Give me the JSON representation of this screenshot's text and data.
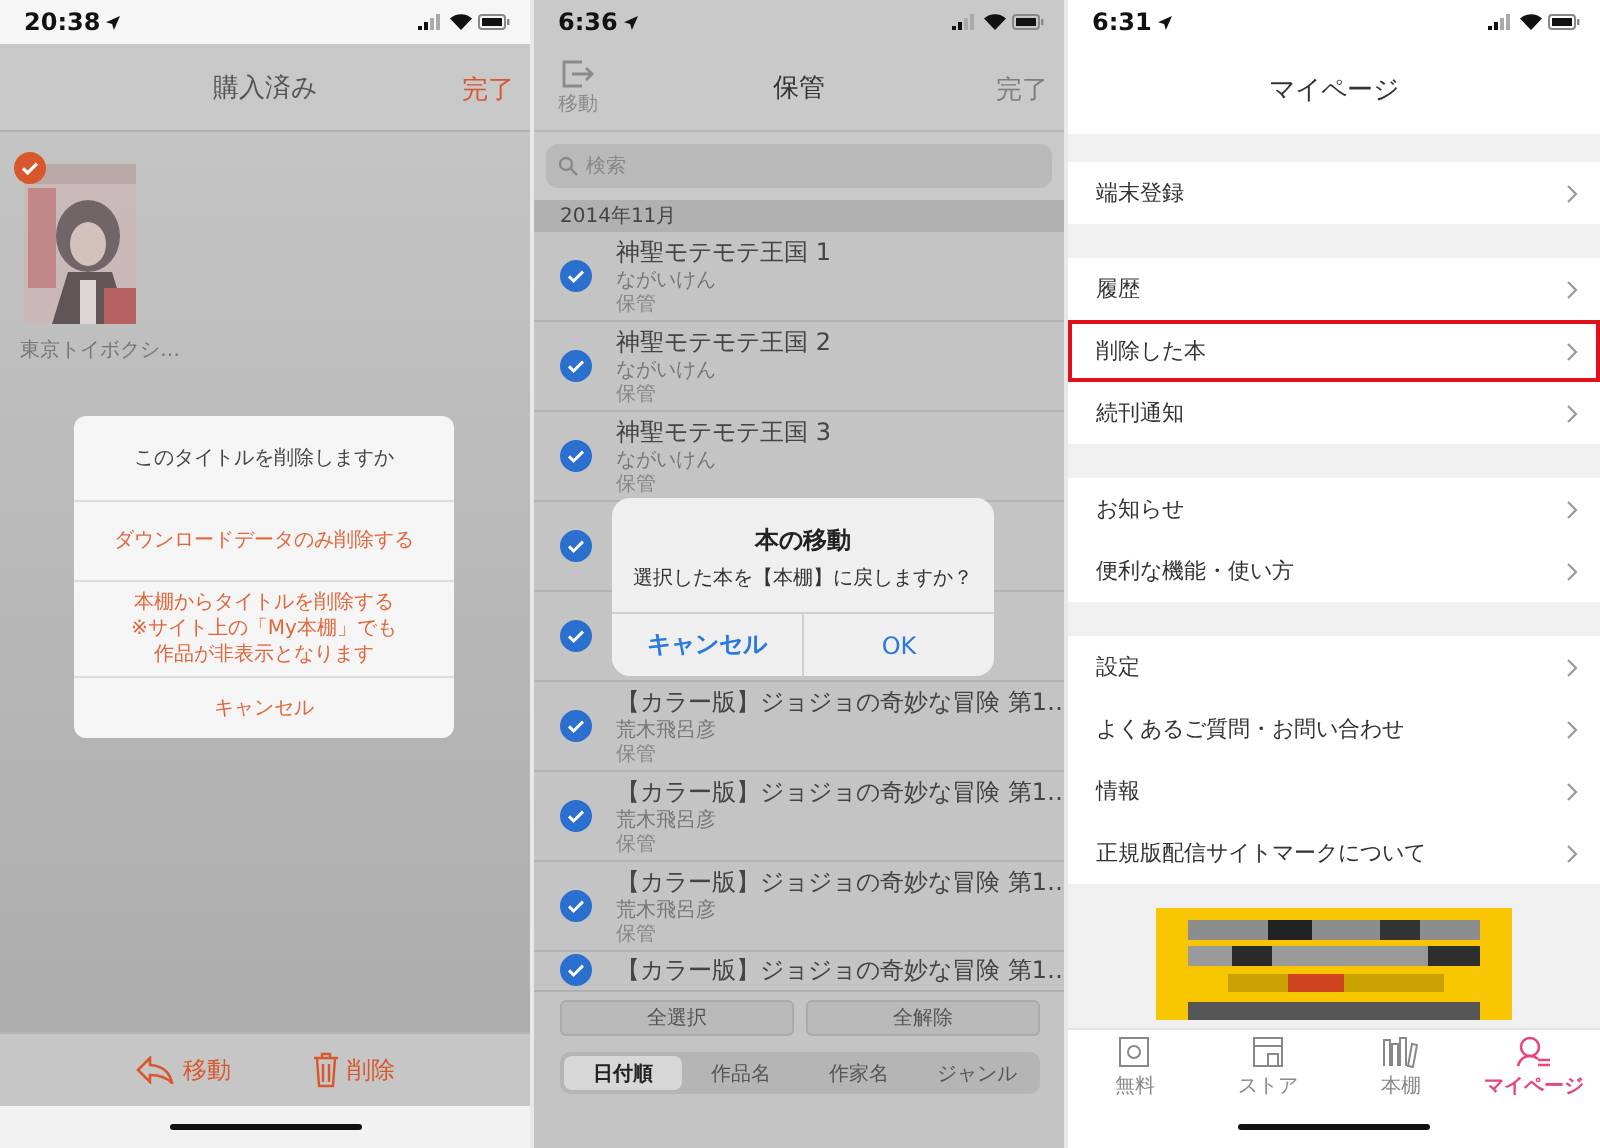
{
  "screens": [
    {
      "kind": "purchased",
      "status_time": "20:38",
      "title": "購入済み",
      "done": "完了",
      "books": [
        {
          "caption": "東京トイボクシ…",
          "checked": true
        }
      ],
      "dialog": {
        "message": "このタイトルを削除しますか",
        "options": [
          {
            "text": "ダウンロードデータのみ削除する"
          },
          {
            "lines": [
              "本棚からタイトルを削除する",
              "※サイト上の「My本棚」でも",
              "作品が非表示となります"
            ]
          },
          {
            "text": "キャンセル"
          }
        ]
      },
      "toolbar": [
        {
          "label": "移動"
        },
        {
          "label": "削除"
        }
      ]
    },
    {
      "kind": "storage",
      "status_time": "6:36",
      "move_label": "移動",
      "title": "保管",
      "done": "完了",
      "search": {
        "placeholder": "検索"
      },
      "section": "2014年11月",
      "rows": [
        {
          "title": "神聖モテモテ王国 1",
          "author": "ながいけん",
          "status": "保管",
          "checked": true
        },
        {
          "title": "神聖モテモテ王国 2",
          "author": "ながいけん",
          "status": "保管",
          "checked": true
        },
        {
          "title": "神聖モテモテ王国 3",
          "author": "ながいけん",
          "status": "保管",
          "checked": true
        },
        {
          "checked": true
        },
        {
          "checked": true
        },
        {
          "title": "【カラー版】ジョジョの奇妙な冒険 第1…",
          "author": "荒木飛呂彦",
          "status": "保管",
          "checked": true
        },
        {
          "title": "【カラー版】ジョジョの奇妙な冒険 第1…",
          "author": "荒木飛呂彦",
          "status": "保管",
          "checked": true
        },
        {
          "title": "【カラー版】ジョジョの奇妙な冒険 第1…",
          "author": "荒木飛呂彦",
          "status": "保管",
          "checked": true
        },
        {
          "title": "【カラー版】ジョジョの奇妙な冒険 第1…",
          "checked": true
        }
      ],
      "dialog": {
        "title": "本の移動",
        "message": "選択した本を【本棚】に戻しますか？",
        "buttons": [
          {
            "label": "キャンセル",
            "bold": true
          },
          {
            "label": "OK",
            "bold": false
          }
        ]
      },
      "actions": [
        "全選択",
        "全解除"
      ],
      "sort": [
        {
          "label": "日付順",
          "selected": true
        },
        {
          "label": "作品名",
          "selected": false
        },
        {
          "label": "作家名",
          "selected": false
        },
        {
          "label": "ジャンル",
          "selected": false
        }
      ]
    },
    {
      "kind": "mypage",
      "status_time": "6:31",
      "title": "マイページ",
      "groups": [
        {
          "items": [
            {
              "label": "端末登録",
              "highlighted": false
            }
          ]
        },
        {
          "items": [
            {
              "label": "履歴",
              "highlighted": false
            },
            {
              "label": "削除した本",
              "highlighted": true
            },
            {
              "label": "続刊通知",
              "highlighted": false
            }
          ]
        },
        {
          "items": [
            {
              "label": "お知らせ",
              "highlighted": false
            },
            {
              "label": "便利な機能・使い方",
              "highlighted": false
            }
          ]
        },
        {
          "items": [
            {
              "label": "設定",
              "highlighted": false
            },
            {
              "label": "よくあるご質問・お問い合わせ",
              "highlighted": false
            },
            {
              "label": "情報",
              "highlighted": false
            },
            {
              "label": "正規版配信サイトマークについて",
              "highlighted": false
            }
          ]
        }
      ],
      "tabs": [
        {
          "label": "無料",
          "selected": false
        },
        {
          "label": "ストア",
          "selected": false
        },
        {
          "label": "本棚",
          "selected": false
        },
        {
          "label": "マイページ",
          "selected": true
        }
      ]
    }
  ]
}
